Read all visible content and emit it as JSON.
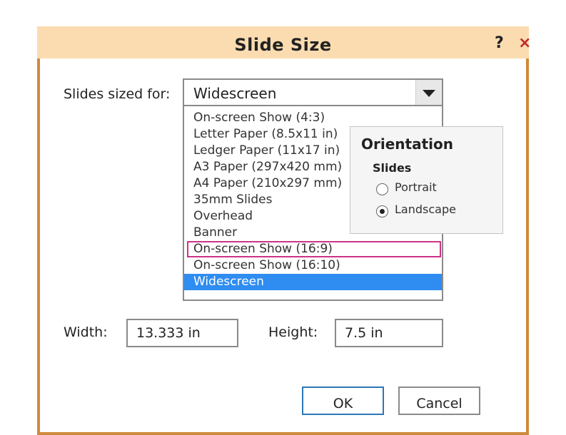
{
  "dialog": {
    "title": "Slide Size",
    "help_label": "?",
    "close_label": "×"
  },
  "slides_sized_for": {
    "label": "Slides sized for:",
    "value": "Widescreen",
    "options": [
      "On-screen Show (4:3)",
      "Letter Paper (8.5x11 in)",
      "Ledger Paper (11x17 in)",
      "A3 Paper (297x420 mm)",
      "A4 Paper (210x297 mm)",
      "35mm Slides",
      "Overhead",
      "Banner",
      "On-screen Show (16:9)",
      "On-screen Show (16:10)",
      "Widescreen"
    ],
    "highlighted_option": "On-screen Show (16:9)",
    "selected_option": "Widescreen"
  },
  "orientation": {
    "title": "Orientation",
    "slides_label": "Slides",
    "portrait_label": "Portrait",
    "landscape_label": "Landscape",
    "selected": "Landscape"
  },
  "size": {
    "width_label": "Width:",
    "width_value": "13.333 in",
    "height_label": "Height:",
    "height_value": "7.5 in"
  },
  "buttons": {
    "ok": "OK",
    "cancel": "Cancel"
  },
  "colors": {
    "titlebar": "#fbdcb0",
    "border": "#d08a3c",
    "close": "#c0282a",
    "selection": "#2f8cf0",
    "highlight_outline": "#cc3388",
    "ok_border": "#2e76b8"
  }
}
